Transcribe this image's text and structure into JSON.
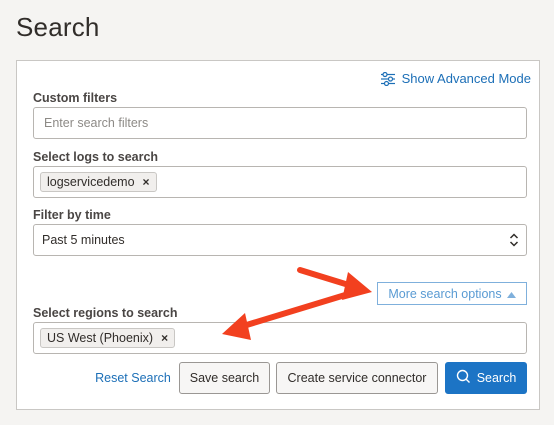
{
  "page": {
    "title": "Search"
  },
  "panel": {
    "advanced_mode_label": "Show Advanced Mode",
    "advanced_mode_icon": "sliders-icon",
    "custom_filters": {
      "label": "Custom filters",
      "placeholder": "Enter search filters",
      "value": ""
    },
    "logs": {
      "label": "Select logs to search",
      "chips": [
        {
          "label": "logservicedemo",
          "remove": "×"
        }
      ]
    },
    "time_filter": {
      "label": "Filter by time",
      "selected": "Past 5 minutes"
    },
    "more_options": {
      "label": "More search options",
      "icon": "caret-up-icon"
    },
    "regions": {
      "label": "Select regions to search",
      "chips": [
        {
          "label": "US West (Phoenix)",
          "remove": "×"
        }
      ]
    },
    "actions": {
      "reset_label": "Reset Search",
      "save_label": "Save search",
      "connector_label": "Create service connector",
      "search_label": "Search",
      "search_icon": "search-icon"
    }
  },
  "colors": {
    "accent": "#1c74c5",
    "link": "#1c6fb7",
    "annotation_arrow": "#f2401f",
    "background": "#f5f4f2"
  }
}
